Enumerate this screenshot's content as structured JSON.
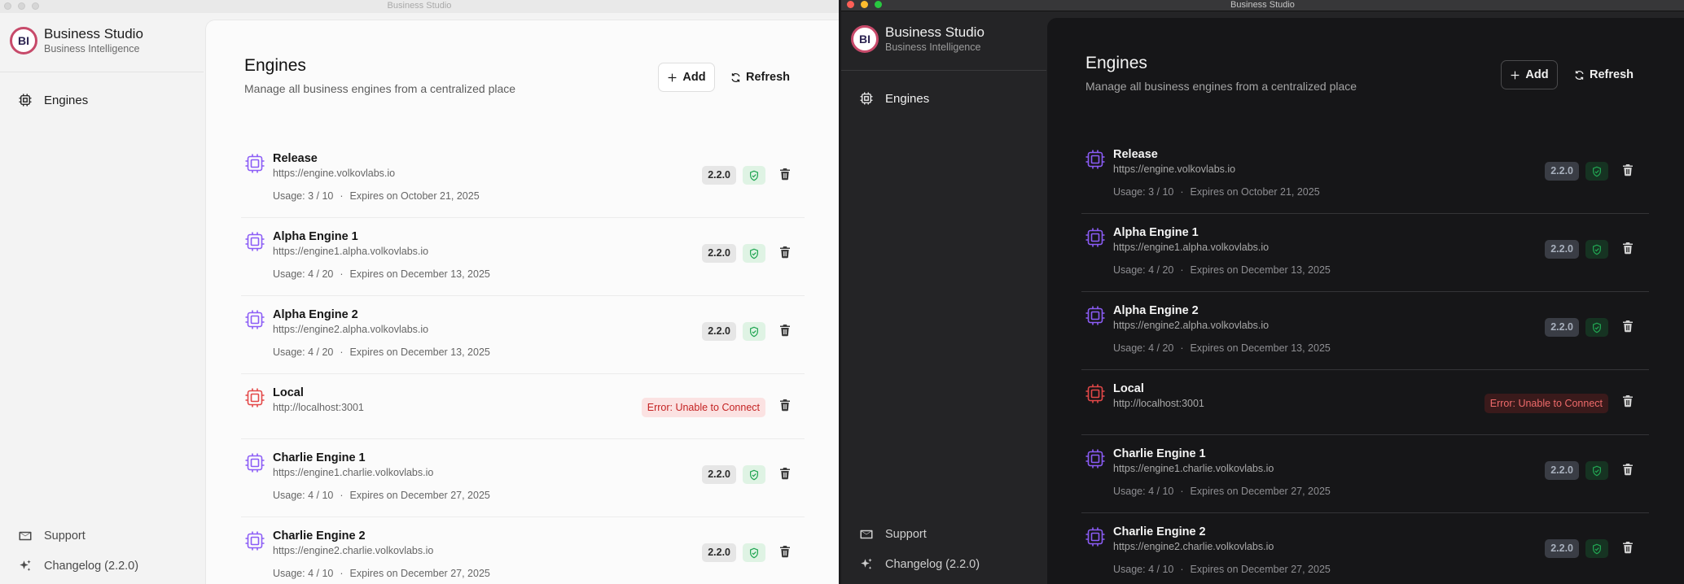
{
  "app": {
    "window_title": "Business Studio",
    "brand_logo": "BI",
    "brand_title": "Business Studio",
    "brand_subtitle": "Business Intelligence"
  },
  "sidebar": {
    "items": [
      {
        "label": "Engines",
        "icon": "cpu-icon"
      }
    ],
    "footer": [
      {
        "label": "Support",
        "icon": "mail-icon"
      },
      {
        "label": "Changelog (2.2.0)",
        "icon": "sparkles-icon"
      }
    ]
  },
  "page": {
    "title": "Engines",
    "subtitle": "Manage all business engines from a centralized place",
    "add_label": "Add",
    "refresh_label": "Refresh"
  },
  "engines": [
    {
      "name": "Release",
      "url": "https://engine.volkovlabs.io",
      "usage": "Usage: 3 / 10",
      "expires": "Expires on October 21, 2025",
      "version": "2.2.0",
      "status": "ok"
    },
    {
      "name": "Alpha Engine 1",
      "url": "https://engine1.alpha.volkovlabs.io",
      "usage": "Usage: 4 / 20",
      "expires": "Expires on December 13, 2025",
      "version": "2.2.0",
      "status": "ok"
    },
    {
      "name": "Alpha Engine 2",
      "url": "https://engine2.alpha.volkovlabs.io",
      "usage": "Usage: 4 / 20",
      "expires": "Expires on December 13, 2025",
      "version": "2.2.0",
      "status": "ok"
    },
    {
      "name": "Local",
      "url": "http://localhost:3001",
      "error": "Error: Unable to Connect",
      "status": "error"
    },
    {
      "name": "Charlie Engine 1",
      "url": "https://engine1.charlie.volkovlabs.io",
      "usage": "Usage: 4 / 10",
      "expires": "Expires on December 27, 2025",
      "version": "2.2.0",
      "status": "ok"
    },
    {
      "name": "Charlie Engine 2",
      "url": "https://engine2.charlie.volkovlabs.io",
      "usage": "Usage: 4 / 10",
      "expires": "Expires on December 27, 2025",
      "version": "2.2.0",
      "status": "ok"
    }
  ],
  "colors": {
    "engine_icon": "#8b5cf6",
    "engine_error_icon": "#e34848",
    "ok_green": "#22a653",
    "error_red": "#c42323"
  }
}
